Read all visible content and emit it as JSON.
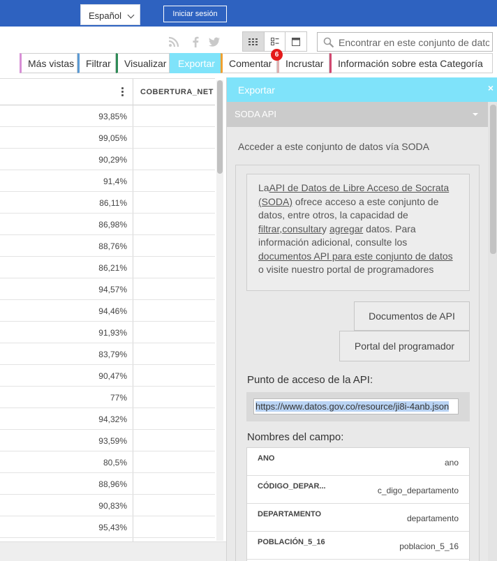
{
  "header": {
    "language_selected": "Español",
    "login_label": "Iniciar sesión"
  },
  "toolbar": {
    "social_icons": [
      "rss-icon",
      "facebook-icon",
      "twitter-icon"
    ],
    "view_modes": [
      "grid-view-icon",
      "card-view-icon",
      "page-view-icon"
    ],
    "active_view": "grid-view-icon",
    "search_placeholder": "Encontrar en este conjunto de datos"
  },
  "tabs": [
    {
      "label": "Más vistas",
      "accent": "#d88fd6"
    },
    {
      "label": "Filtrar",
      "accent": "#5b9bd5"
    },
    {
      "label": "Visualizar",
      "accent": "#2e8b57"
    },
    {
      "label": "Exportar",
      "accent": "#7fe3fa",
      "active": true
    },
    {
      "label": "Comentar",
      "accent": "#f0a030"
    },
    {
      "label": "Incrustar",
      "accent": "#e0b0b0"
    },
    {
      "label": "Información sobre esta Categoría",
      "accent": "#d04870"
    }
  ],
  "comment_badge": "6",
  "table": {
    "column_header": "COBERTURA_NET",
    "values": [
      "93,85%",
      "99,05%",
      "90,29%",
      "91,4%",
      "86,11%",
      "86,98%",
      "88,76%",
      "86,21%",
      "94,57%",
      "94,46%",
      "91,93%",
      "83,79%",
      "90,47%",
      "77%",
      "94,32%",
      "93,59%",
      "80,5%",
      "88,96%",
      "90,83%",
      "95,43%"
    ]
  },
  "export_panel": {
    "title": "Exportar",
    "close_label": "×",
    "section_title": "SODA API",
    "section_description": "Acceder a este conjunto de datos vía SODA",
    "info": {
      "t1": "La",
      "link1": "API de Datos de Libre Acceso de Socrata (SODA)",
      "t2": " ofrece acceso a este conjunto de datos, entre otros, la capacidad de ",
      "link2": "filtrar",
      "t3": ",",
      "link3": "consultar",
      "t4": "y ",
      "link4": "agregar",
      "t5": " datos. Para información adicional, consulte los ",
      "link5": "documentos API para este conjunto de datos",
      "t6": " o visite nuestro portal de programadores"
    },
    "docs_button": "Documentos de API",
    "developer_button": "Portal del programador",
    "endpoint_label": "Punto de acceso de la API:",
    "endpoint_url": "https://www.datos.gov.co/resource/ji8i-4anb.json",
    "fields_label": "Nombres del campo:",
    "fields": [
      {
        "name": "ANO",
        "key": "ano"
      },
      {
        "name": "CÓDIGO_DEPAR...",
        "key": "c_digo_departamento"
      },
      {
        "name": "DEPARTAMENTO",
        "key": "departamento"
      },
      {
        "name": "POBLACIÓN_5_16",
        "key": "poblacion_5_16"
      }
    ]
  },
  "colors": {
    "topbar": "#2e62c0",
    "export_accent": "#7fe3fa",
    "badge": "#e41b1b"
  }
}
